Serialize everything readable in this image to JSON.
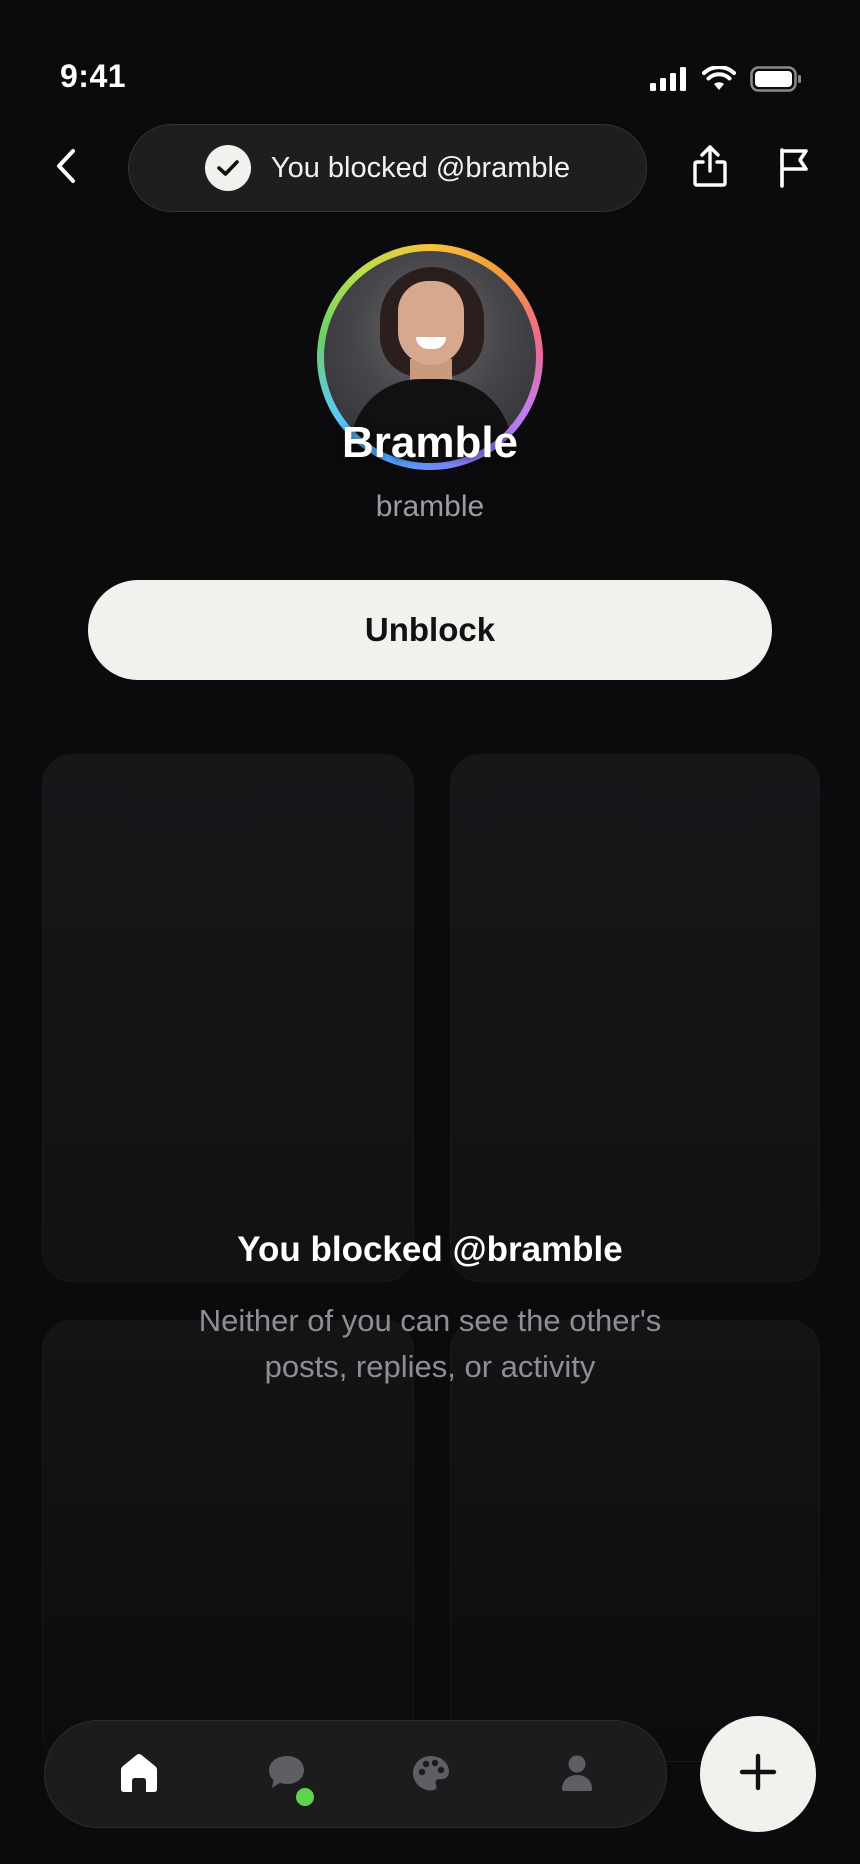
{
  "status_bar": {
    "time": "9:41",
    "icons": [
      "cellular-signal-icon",
      "wifi-icon",
      "battery-icon"
    ]
  },
  "top_bar": {
    "back_icon": "chevron-left-icon",
    "toast": {
      "icon": "checkmark-icon",
      "text": "You blocked @bramble"
    },
    "share_icon": "share-icon",
    "report_icon": "flag-icon"
  },
  "profile": {
    "name": "Bramble",
    "handle": "bramble",
    "avatar_ring_colors": [
      "#4aa3ff",
      "#6ad06a",
      "#f6c23c",
      "#ef6a8a",
      "#c37cf0"
    ]
  },
  "actions": {
    "unblock_label": "Unblock"
  },
  "blocked_notice": {
    "title": "You blocked @bramble",
    "description": "Neither of you can see the other's posts, replies, or activity"
  },
  "bottom_nav": {
    "items": [
      {
        "icon": "home-icon",
        "active": true
      },
      {
        "icon": "messages-icon",
        "active": false,
        "badge": "unread-dot"
      },
      {
        "icon": "palette-icon",
        "active": false
      },
      {
        "icon": "profile-icon",
        "active": false
      }
    ],
    "fab_icon": "plus-icon"
  },
  "colors": {
    "background": "#0b0b0d",
    "button_light": "#f2f1ee",
    "badge": "#5fd44a",
    "muted_text": "#8e8e93"
  }
}
